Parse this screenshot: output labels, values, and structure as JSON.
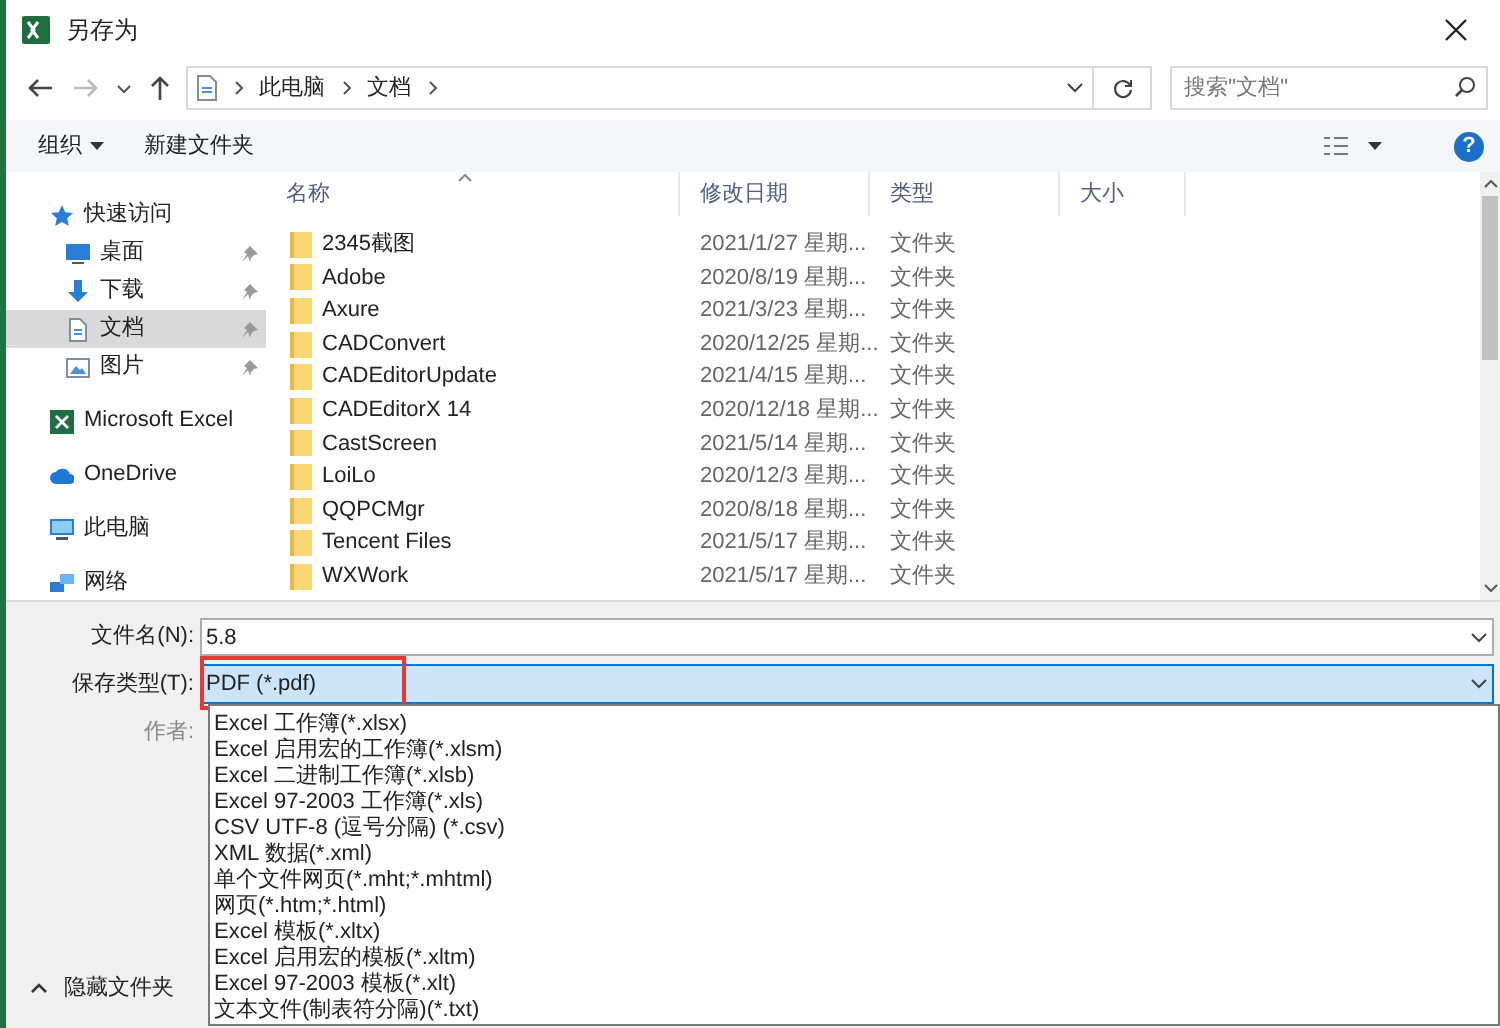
{
  "window": {
    "title": "另存为"
  },
  "address": {
    "path": [
      "此电脑",
      "文档"
    ]
  },
  "search": {
    "placeholder": "搜索\"文档\""
  },
  "toolbar": {
    "buttons": [
      "组织",
      "新建文件夹"
    ]
  },
  "sidebar": {
    "items": [
      {
        "label": "快速访问",
        "kind": "star",
        "selected": false,
        "children": [
          {
            "label": "桌面",
            "kind": "desktop",
            "selected": false,
            "pinned": true
          },
          {
            "label": "下载",
            "kind": "download",
            "selected": false,
            "pinned": true
          },
          {
            "label": "文档",
            "kind": "document",
            "selected": true,
            "pinned": true
          },
          {
            "label": "图片",
            "kind": "picture",
            "selected": false,
            "pinned": true
          }
        ]
      },
      {
        "label": "Microsoft Excel",
        "kind": "excel",
        "selected": false
      },
      {
        "label": "OneDrive",
        "kind": "cloud",
        "selected": false
      },
      {
        "label": "此电脑",
        "kind": "computer",
        "selected": false
      },
      {
        "label": "网络",
        "kind": "network",
        "selected": false
      }
    ]
  },
  "table": {
    "columns": [
      {
        "label": "名称",
        "sorted": true
      },
      {
        "label": "修改日期",
        "sorted": false
      },
      {
        "label": "类型",
        "sorted": false
      },
      {
        "label": "大小",
        "sorted": false
      }
    ],
    "rows": [
      {
        "name": "2345截图",
        "date": "2021/1/27 星期...",
        "type": "文件夹"
      },
      {
        "name": "Adobe",
        "date": "2020/8/19 星期...",
        "type": "文件夹"
      },
      {
        "name": "Axure",
        "date": "2021/3/23 星期...",
        "type": "文件夹"
      },
      {
        "name": "CADConvert",
        "date": "2020/12/25 星期...",
        "type": "文件夹"
      },
      {
        "name": "CADEditorUpdate",
        "date": "2021/4/15 星期...",
        "type": "文件夹"
      },
      {
        "name": "CADEditorX 14",
        "date": "2020/12/18 星期...",
        "type": "文件夹"
      },
      {
        "name": "CastScreen",
        "date": "2021/5/14 星期...",
        "type": "文件夹"
      },
      {
        "name": "LoiLo",
        "date": "2020/12/3 星期...",
        "type": "文件夹"
      },
      {
        "name": "QQPCMgr",
        "date": "2020/8/18 星期...",
        "type": "文件夹"
      },
      {
        "name": "Tencent Files",
        "date": "2021/5/17 星期...",
        "type": "文件夹"
      },
      {
        "name": "WXWork",
        "date": "2021/5/17 星期...",
        "type": "文件夹"
      }
    ]
  },
  "form": {
    "filename": {
      "label": "文件名(N):",
      "value": "5.8"
    },
    "save_type": {
      "label": "保存类型(T):",
      "value": "PDF (*.pdf)",
      "highlighted": true
    },
    "author": {
      "label": "作者:"
    },
    "options": [
      "Excel 工作簿(*.xlsx)",
      "Excel 启用宏的工作簿(*.xlsm)",
      "Excel 二进制工作簿(*.xlsb)",
      "Excel 97-2003 工作簿(*.xls)",
      "CSV UTF-8 (逗号分隔) (*.csv)",
      "XML 数据(*.xml)",
      "单个文件网页(*.mht;*.mhtml)",
      "网页(*.htm;*.html)",
      "Excel 模板(*.xltx)",
      "Excel 启用宏的模板(*.xltm)",
      "Excel 97-2003 模板(*.xlt)",
      "文本文件(制表符分隔)(*.txt)"
    ]
  },
  "hide_folders": {
    "label": "隐藏文件夹"
  },
  "help_button": {
    "label": "?"
  }
}
